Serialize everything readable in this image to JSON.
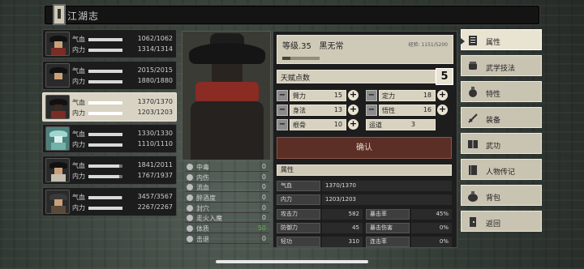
{
  "title": "江湖志",
  "characters": [
    {
      "qi_label": "气血",
      "qi": "1062/1062",
      "qi_pct": 1.0,
      "nei_label": "内力",
      "nei": "1314/1314",
      "nei_pct": 1.0,
      "active": false
    },
    {
      "qi_label": "气血",
      "qi": "2015/2015",
      "qi_pct": 1.0,
      "nei_label": "内力",
      "nei": "1880/1880",
      "nei_pct": 1.0,
      "active": false
    },
    {
      "qi_label": "气血",
      "qi": "1370/1370",
      "qi_pct": 1.0,
      "nei_label": "内力",
      "nei": "1203/1203",
      "nei_pct": 1.0,
      "active": true
    },
    {
      "qi_label": "气血",
      "qi": "1330/1330",
      "qi_pct": 1.0,
      "nei_label": "内力",
      "nei": "1110/1110",
      "nei_pct": 1.0,
      "active": false
    },
    {
      "qi_label": "气血",
      "qi": "1841/2011",
      "qi_pct": 0.915,
      "nei_label": "内力",
      "nei": "1767/1937",
      "nei_pct": 0.912,
      "active": false
    },
    {
      "qi_label": "气血",
      "qi": "3457/3567",
      "qi_pct": 0.969,
      "nei_label": "内力",
      "nei": "2267/2267",
      "nei_pct": 1.0,
      "active": false
    }
  ],
  "effects": [
    {
      "name": "中毒",
      "value": "0"
    },
    {
      "name": "内伤",
      "value": "0"
    },
    {
      "name": "流血",
      "value": "0"
    },
    {
      "name": "醉酒度",
      "value": "0"
    },
    {
      "name": "封穴",
      "value": "0"
    },
    {
      "name": "走火入魔",
      "value": "0"
    },
    {
      "name": "体质",
      "value": "50",
      "highlight": true
    },
    {
      "name": "击退",
      "value": "0"
    }
  ],
  "level": {
    "text": "等级.35",
    "name": "黑无常",
    "exp": "经验: 1151/5200",
    "exp_pct": 0.22
  },
  "talent": {
    "label": "天赋点数",
    "value": "5"
  },
  "attributes": [
    {
      "name": "臂力",
      "value": "15"
    },
    {
      "name": "定力",
      "value": "18"
    },
    {
      "name": "身法",
      "value": "13"
    },
    {
      "name": "悟性",
      "value": "16"
    },
    {
      "name": "根骨",
      "value": "10"
    },
    {
      "name": "运道",
      "value": "3"
    }
  ],
  "confirm_label": "确认",
  "attr_section_title": "属性",
  "hp_row": {
    "label": "气血",
    "value": "1370/1370"
  },
  "mp_row": {
    "label": "内力",
    "value": "1203/1203"
  },
  "stats": [
    {
      "label": "攻击力",
      "value": "582"
    },
    {
      "label": "暴击率",
      "value": "45%"
    },
    {
      "label": "防御力",
      "value": "45"
    },
    {
      "label": "暴击伤害",
      "value": "0%"
    },
    {
      "label": "轻功",
      "value": "310"
    },
    {
      "label": "连击率",
      "value": "0%"
    }
  ],
  "menu": [
    {
      "label": "属性",
      "icon": "scroll-icon",
      "active": true
    },
    {
      "label": "武学技法",
      "icon": "fist-icon"
    },
    {
      "label": "特性",
      "icon": "medal-icon"
    },
    {
      "label": "装备",
      "icon": "sword-icon"
    },
    {
      "label": "武功",
      "icon": "manual-icon"
    },
    {
      "label": "人物传记",
      "icon": "book-icon"
    },
    {
      "label": "背包",
      "icon": "bag-icon"
    },
    {
      "label": "返回",
      "icon": "exit-icon"
    }
  ],
  "colors": {
    "panel": "#1d1d1d",
    "parchment": "#cfc9b8",
    "confirm": "#5b2f26",
    "green": "#5fbf3f"
  }
}
